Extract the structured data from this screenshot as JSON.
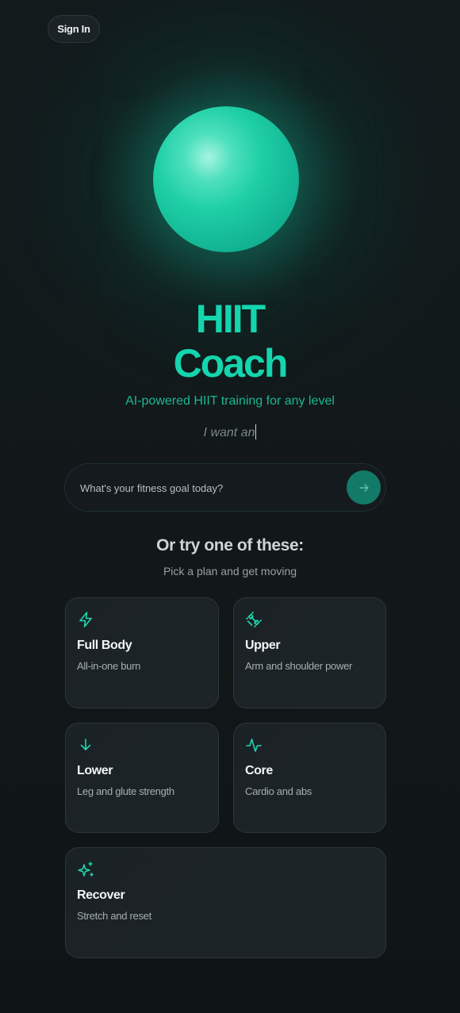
{
  "header": {
    "signin_label": "Sign In"
  },
  "hero": {
    "title_line1": "HIIT",
    "title_line2": "Coach",
    "subtitle": "AI-powered HIIT training for any level",
    "typing_text": "I want an"
  },
  "goal_input": {
    "placeholder": "What's your fitness goal today?",
    "value": "",
    "send_icon": "arrow-right-icon"
  },
  "suggestions": {
    "title": "Or try one of these:",
    "subtitle": "Pick a plan and get moving",
    "cards": [
      {
        "name": "Full Body",
        "desc": "All-in-one burn",
        "icon": "lightning-icon"
      },
      {
        "name": "Upper",
        "desc": "Arm and shoulder power",
        "icon": "dumbbell-icon"
      },
      {
        "name": "Lower",
        "desc": "Leg and glute strength",
        "icon": "arrow-down-icon"
      },
      {
        "name": "Core",
        "desc": "Cardio and abs",
        "icon": "pulse-icon"
      },
      {
        "name": "Recover",
        "desc": "Stretch and reset",
        "icon": "sparkles-icon"
      }
    ]
  },
  "colors": {
    "accent": "#14d5ad",
    "accent_dark": "#127a66",
    "background": "#111619",
    "card": "#1b2226"
  }
}
